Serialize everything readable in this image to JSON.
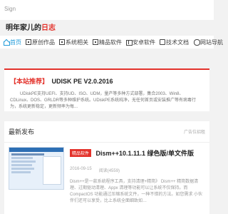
{
  "topbar": {
    "sign": "Sign"
  },
  "brand": {
    "prefix": "明年家儿的",
    "highlight": "日志"
  },
  "nav": {
    "items": [
      {
        "label": "首页",
        "icon": "home-icon"
      },
      {
        "label": "原创作品",
        "icon": "grid-icon"
      },
      {
        "label": "系统相关",
        "icon": "grid-icon"
      },
      {
        "label": "精品软件",
        "icon": "grid-icon"
      },
      {
        "label": "安卓软件",
        "icon": "android-icon"
      },
      {
        "label": "技术文档",
        "icon": "book-icon"
      },
      {
        "label": "网站导航",
        "icon": "link-icon"
      }
    ],
    "active_color": "#1f9ad9"
  },
  "announcement": {
    "tag": "【本站推荐】",
    "title": "UDISK PE V2.0.2016",
    "description": "UDiskPE支持UEFI、支持UD、ISO、UDM，量产等多种方式部署，集合2003、Win8、CDLinux、DOS、GRLDR等多种维护系统。UDiskPE系统纯净，无任何首页或安装推广等有病毒行为，系统更新稳定，更新频率为每..."
  },
  "latest": {
    "heading": "最新发布",
    "ad_label": "广告位招租",
    "post": {
      "category": "精品软件",
      "title": "Dism++10.1.11.1 绿色版/单文件版",
      "date": "2016-09-15",
      "views": "阅读(4559)",
      "excerpt": "Dism++是一款系统程序工具，支持清理+精简》 Dism++ 精简数据清理、过期驱动清理、Appx 清理等功能可以让系统不仅保持。而 CompactOS 功能通过压缩系统文件，一种不错的方法。如您需求 小伙伴们还可以享受，比上系统全面细致如…"
    }
  },
  "colors": {
    "accent": "#e3322b",
    "background": "#f2f2f2"
  }
}
